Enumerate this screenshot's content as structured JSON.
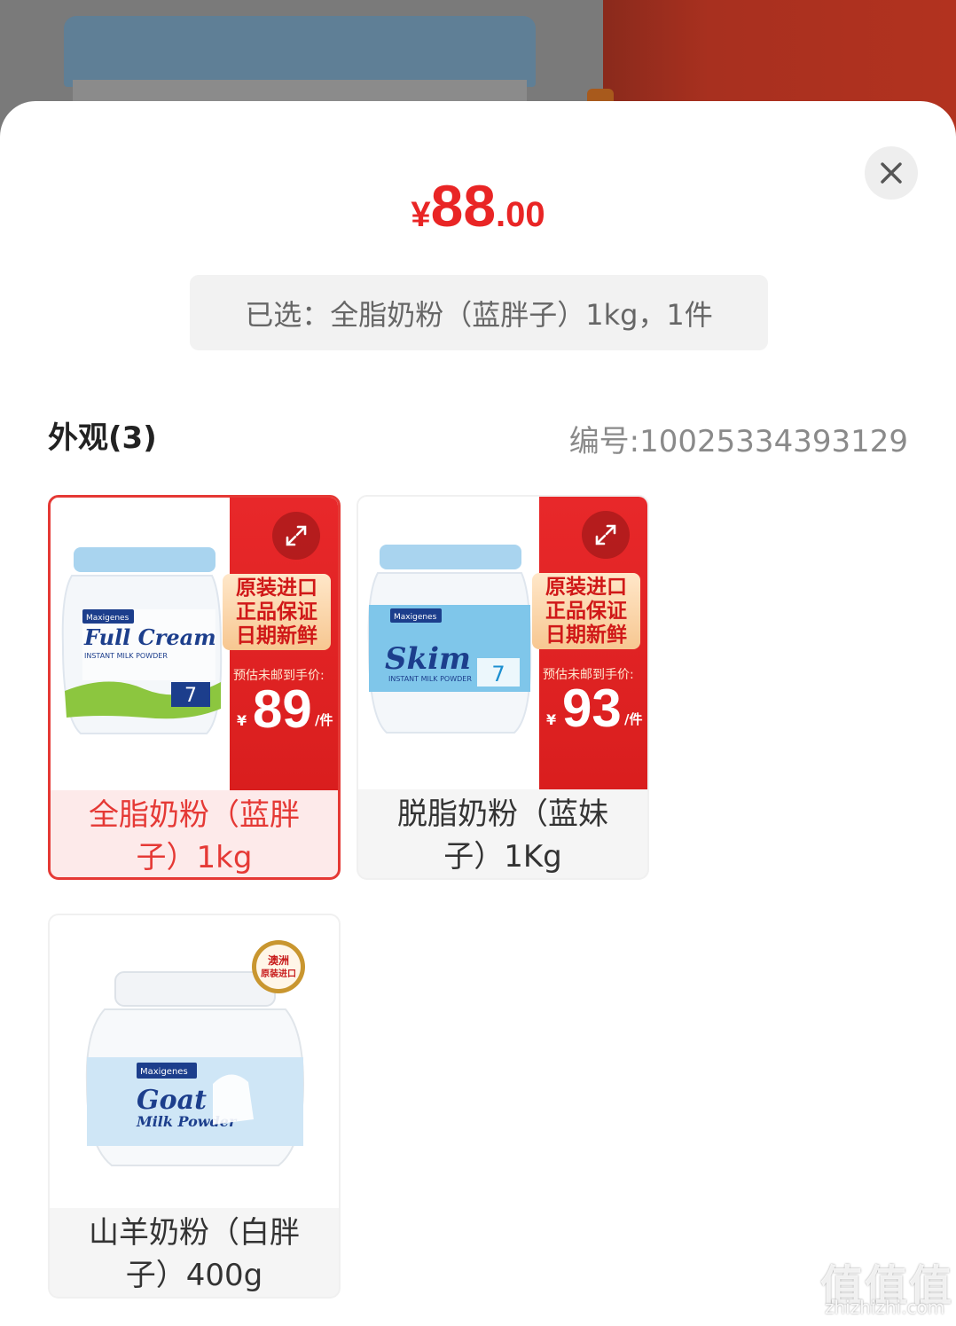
{
  "price": {
    "currency": "¥",
    "integer": "88",
    "decimal": ".00"
  },
  "selection": {
    "text": "已选：全脂奶粉（蓝胖子）1kg，1件"
  },
  "section": {
    "title": "外观(3)",
    "code": "编号:10025334393129"
  },
  "variants": [
    {
      "label": "全脂奶粉（蓝胖子）1kg",
      "selected": true,
      "brand": "Maxigenes",
      "product_name": "Full Cream",
      "product_sub": "INSTANT MILK POWDER",
      "promo_badge": [
        "原装进口",
        "正品保证",
        "日期新鲜"
      ],
      "promo_note": "预估未邮到手价:",
      "promo_currency": "¥",
      "promo_price": "89",
      "promo_unit": "/件"
    },
    {
      "label": "脱脂奶粉（蓝妹子）1Kg",
      "selected": false,
      "brand": "Maxigenes",
      "product_name": "Skim",
      "product_sub": "INSTANT MILK POWDER",
      "promo_badge": [
        "原装进口",
        "正品保证",
        "日期新鲜"
      ],
      "promo_note": "预估未邮到手价:",
      "promo_currency": "¥",
      "promo_price": "93",
      "promo_unit": "/件"
    },
    {
      "label": "山羊奶粉（白胖子）400g",
      "selected": false,
      "brand": "Maxigenes",
      "product_name": "Goat",
      "product_sub": "Milk Powder",
      "seal_top": "澳洲",
      "seal_bottom": "原装进口"
    }
  ],
  "watermark": {
    "main": "值值值",
    "sub": "zhizhizhi.com"
  },
  "colors": {
    "accent": "#e92525",
    "selected_border": "#e53935",
    "promo_red": "#e8282a"
  },
  "icons": {
    "close": "close-icon",
    "expand": "expand-icon"
  }
}
